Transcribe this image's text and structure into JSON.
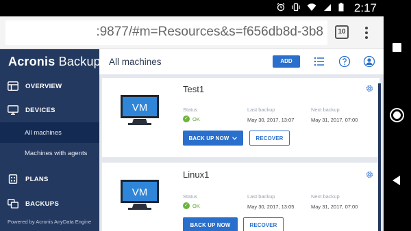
{
  "status_bar": {
    "time": "2:17",
    "icons": [
      "alarm-icon",
      "vibrate-icon",
      "wifi-icon",
      "signal-icon",
      "battery-icon"
    ]
  },
  "browser": {
    "url": ":9877/#m=Resources&s=f656db8d-3b8",
    "tab_count": "10"
  },
  "sidebar": {
    "logo_brand": "Acronis",
    "logo_product": "Backup",
    "items": [
      {
        "label": "OVERVIEW",
        "icon": "overview-icon"
      },
      {
        "label": "DEVICES",
        "icon": "monitor-icon"
      },
      {
        "label": "PLANS",
        "icon": "plans-icon"
      },
      {
        "label": "BACKUPS",
        "icon": "backups-icon"
      }
    ],
    "sub_items": [
      {
        "label": "All machines",
        "active": true
      },
      {
        "label": "Machines with agents",
        "active": false
      }
    ],
    "footer": "Powered by Acronis AnyData Engine"
  },
  "header": {
    "title": "All machines",
    "add_label": "ADD"
  },
  "labels": {
    "status": "Status",
    "last_backup": "Last backup",
    "next_backup": "Next backup",
    "vm_badge": "VM"
  },
  "machines": [
    {
      "name": "Test1",
      "status": "OK",
      "last_backup": "May 30, 2017, 13:07",
      "next_backup": "May 31, 2017, 07:00",
      "backup_label": "BACK UP NOW",
      "recover_label": "RECOVER"
    },
    {
      "name": "Linux1",
      "status": "OK",
      "last_backup": "May 30, 2017, 13:05",
      "next_backup": "May 31, 2017, 07:00",
      "backup_label": "BACK UP NOW",
      "recover_label": "RECOVER"
    }
  ],
  "colors": {
    "sidebar_bg": "#24395f",
    "active_item_bg": "#132a52",
    "accent": "#2a6fcc",
    "ok_green": "#6ab53a"
  }
}
